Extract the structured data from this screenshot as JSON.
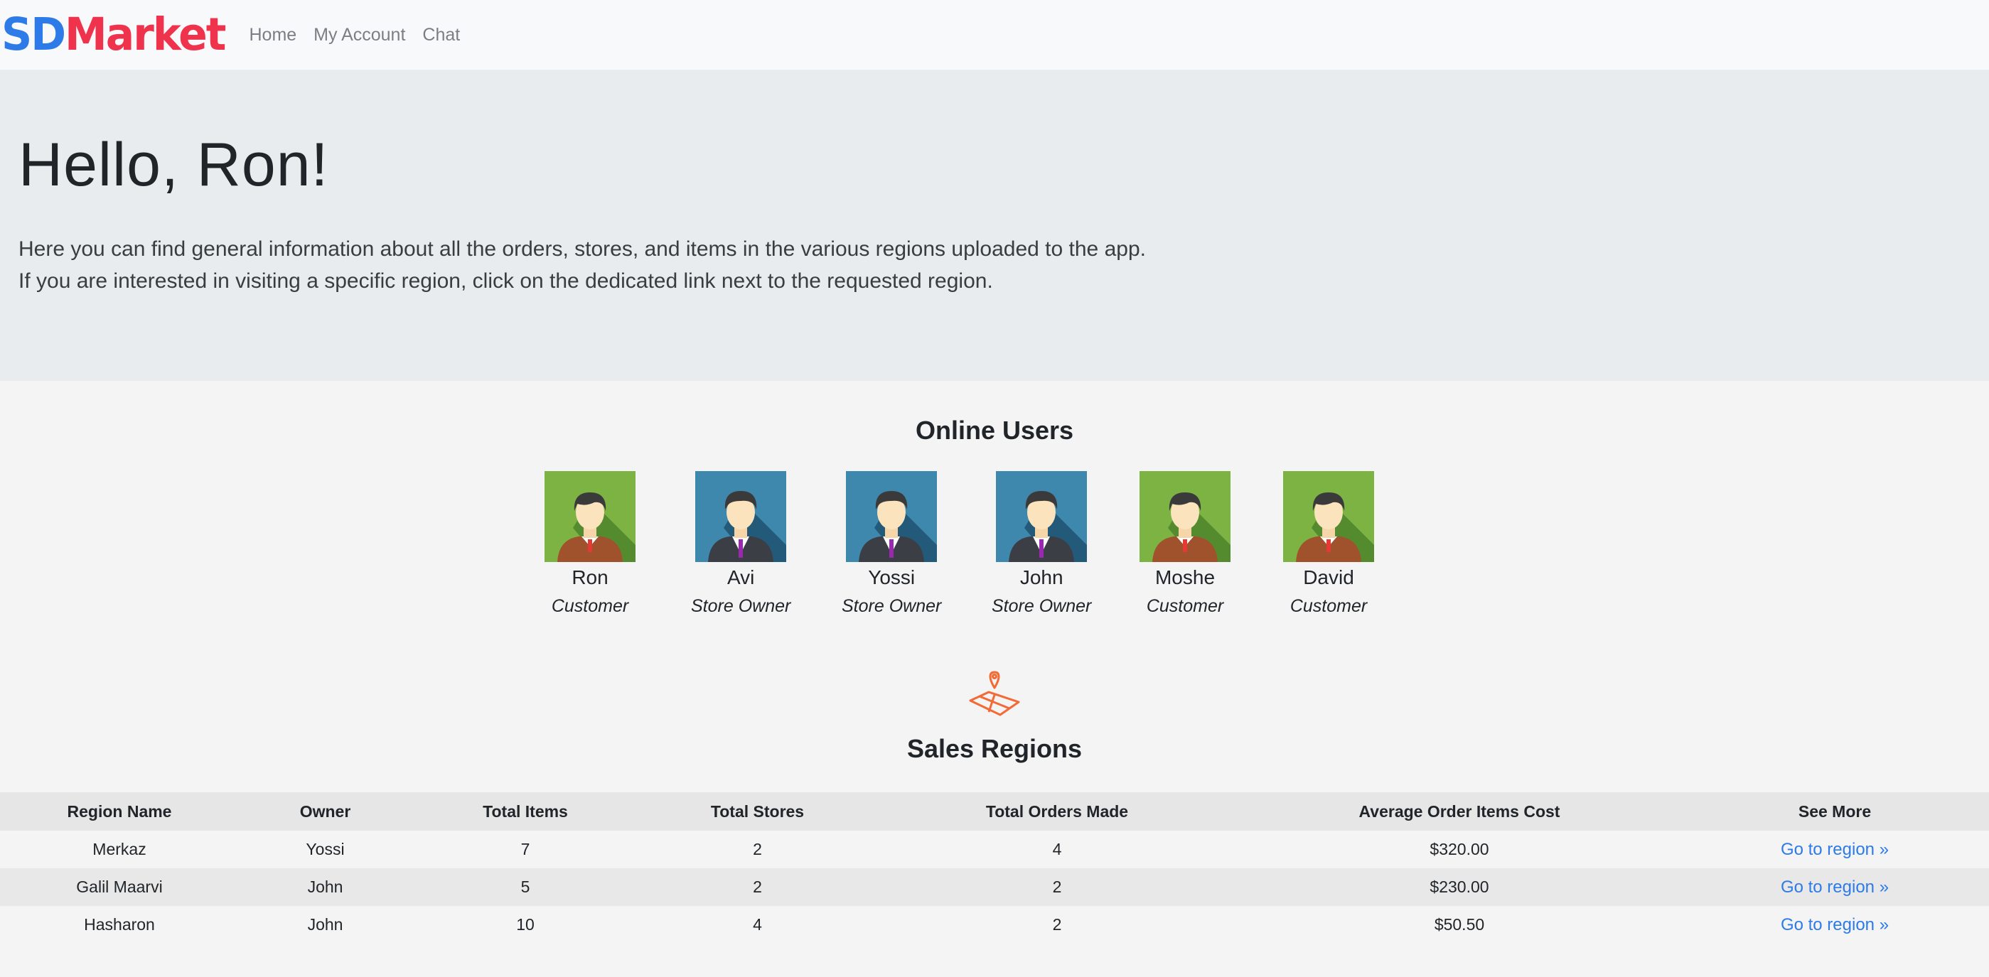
{
  "brand": {
    "part1": "SD",
    "part2": "Market"
  },
  "nav": {
    "items": [
      "Home",
      "My Account",
      "Chat"
    ]
  },
  "jumbotron": {
    "heading": "Hello, Ron!",
    "line1": "Here you can find general information about all the orders, stores, and items in the various regions uploaded to the app.",
    "line2": "If you are interested in visiting a specific region, click on the dedicated link next to the requested region."
  },
  "online_users": {
    "title": "Online Users",
    "users": [
      {
        "name": "Ron",
        "role": "Customer",
        "avatar": "customer-avatar-icon"
      },
      {
        "name": "Avi",
        "role": "Store Owner",
        "avatar": "store-owner-avatar-icon"
      },
      {
        "name": "Yossi",
        "role": "Store Owner",
        "avatar": "store-owner-avatar-icon"
      },
      {
        "name": "John",
        "role": "Store Owner",
        "avatar": "store-owner-avatar-icon"
      },
      {
        "name": "Moshe",
        "role": "Customer",
        "avatar": "customer-avatar-icon"
      },
      {
        "name": "David",
        "role": "Customer",
        "avatar": "customer-avatar-icon"
      }
    ]
  },
  "sales_regions": {
    "icon": "map-pin-icon",
    "title": "Sales Regions",
    "columns": [
      "Region Name",
      "Owner",
      "Total Items",
      "Total Stores",
      "Total Orders Made",
      "Average Order Items Cost",
      "See More"
    ],
    "rows": [
      {
        "region": "Merkaz",
        "owner": "Yossi",
        "items": "7",
        "stores": "2",
        "orders": "4",
        "avg_cost": "$320.00",
        "link": "Go to region »"
      },
      {
        "region": "Galil Maarvi",
        "owner": "John",
        "items": "5",
        "stores": "2",
        "orders": "2",
        "avg_cost": "$230.00",
        "link": "Go to region »"
      },
      {
        "region": "Hasharon",
        "owner": "John",
        "items": "10",
        "stores": "4",
        "orders": "2",
        "avg_cost": "$50.50",
        "link": "Go to region »"
      }
    ]
  },
  "colors": {
    "brand_blue": "#2d7be8",
    "brand_red": "#f0334d",
    "customer_bg": "#7cb342",
    "store_owner_bg": "#2f6f95",
    "map_icon": "#f26a35",
    "link": "#2d7be8"
  }
}
